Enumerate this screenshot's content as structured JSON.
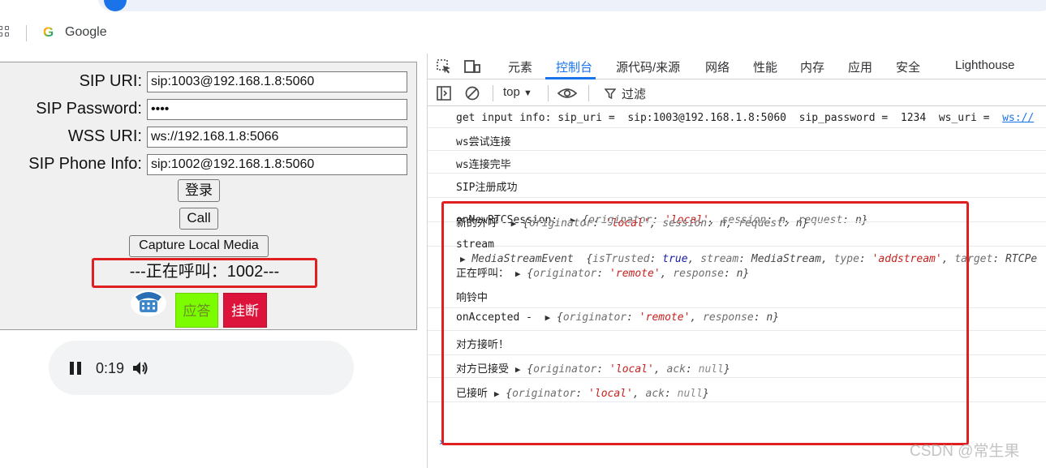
{
  "browser": {
    "bookmark_label": "Google"
  },
  "sip_form": {
    "fields": [
      {
        "label": "SIP URI:",
        "value": "sip:1003@192.168.1.8:5060"
      },
      {
        "label": "SIP Password:",
        "value": "••••"
      },
      {
        "label": "WSS URI:",
        "value": "ws://192.168.1.8:5066"
      },
      {
        "label": "SIP Phone Info:",
        "value": "sip:1002@192.168.1.8:5060"
      }
    ],
    "login_label": "登录",
    "call_label": "Call",
    "capture_label": "Capture Local Media",
    "calling_status": "---正在呼叫：1002---",
    "answer_label": "应答",
    "hangup_label": "挂断"
  },
  "audio": {
    "time": "0:19"
  },
  "devtools": {
    "tabs": [
      "元素",
      "控制台",
      "源代码/来源",
      "网络",
      "性能",
      "内存",
      "应用",
      "安全",
      "Lighthouse"
    ],
    "active_tab": "控制台",
    "context": "top",
    "filter_placeholder": "过滤"
  },
  "console": {
    "line1": {
      "prefix": "get input info: sip_uri =  sip:1003@192.168.1.8:5060  sip_password =  1234  ws_uri =  ",
      "link": "ws://"
    },
    "line2": "ws尝试连接",
    "line3": "ws连接完毕",
    "line4": "SIP注册成功",
    "line5": {
      "label": "onNewRTCSession: ",
      "k1": "originator",
      "v1": "'local'",
      "k2": "session",
      "v2": "n",
      "k3": "request",
      "v3": "n"
    },
    "line6": {
      "label": "新的外呼 ",
      "k1": "originator",
      "v1": "'local'",
      "k2": "session",
      "v2": "n",
      "k3": "request",
      "v3": "n"
    },
    "line7": {
      "label": "stream",
      "cls": "MediaStreamEvent",
      "k1": "isTrusted",
      "v1": "true",
      "k2": "stream",
      "v2": "MediaStream",
      "k3": "type",
      "v3": "'addstream'",
      "k4": "target",
      "v4": "RTCPe"
    },
    "line8": {
      "label": "正在呼叫： ",
      "k1": "originator",
      "v1": "'remote'",
      "k2": "response",
      "v2": "n"
    },
    "line9": "响铃中",
    "line10": {
      "label": "onAccepted -  ",
      "k1": "originator",
      "v1": "'remote'",
      "k2": "response",
      "v2": "n"
    },
    "line11": "对方接听！",
    "line12": {
      "label": "对方已接受 ",
      "k1": "originator",
      "v1": "'local'",
      "k2": "ack",
      "v2": "null"
    },
    "line13": {
      "label": "已接听 ",
      "k1": "originator",
      "v1": "'local'",
      "k2": "ack",
      "v2": "null"
    }
  },
  "watermark": "CSDN @常生果",
  "colors": {
    "accent": "#1a73e8",
    "highlight": "#e02020",
    "answer": "#7cfc00",
    "hangup": "#dc143c"
  }
}
